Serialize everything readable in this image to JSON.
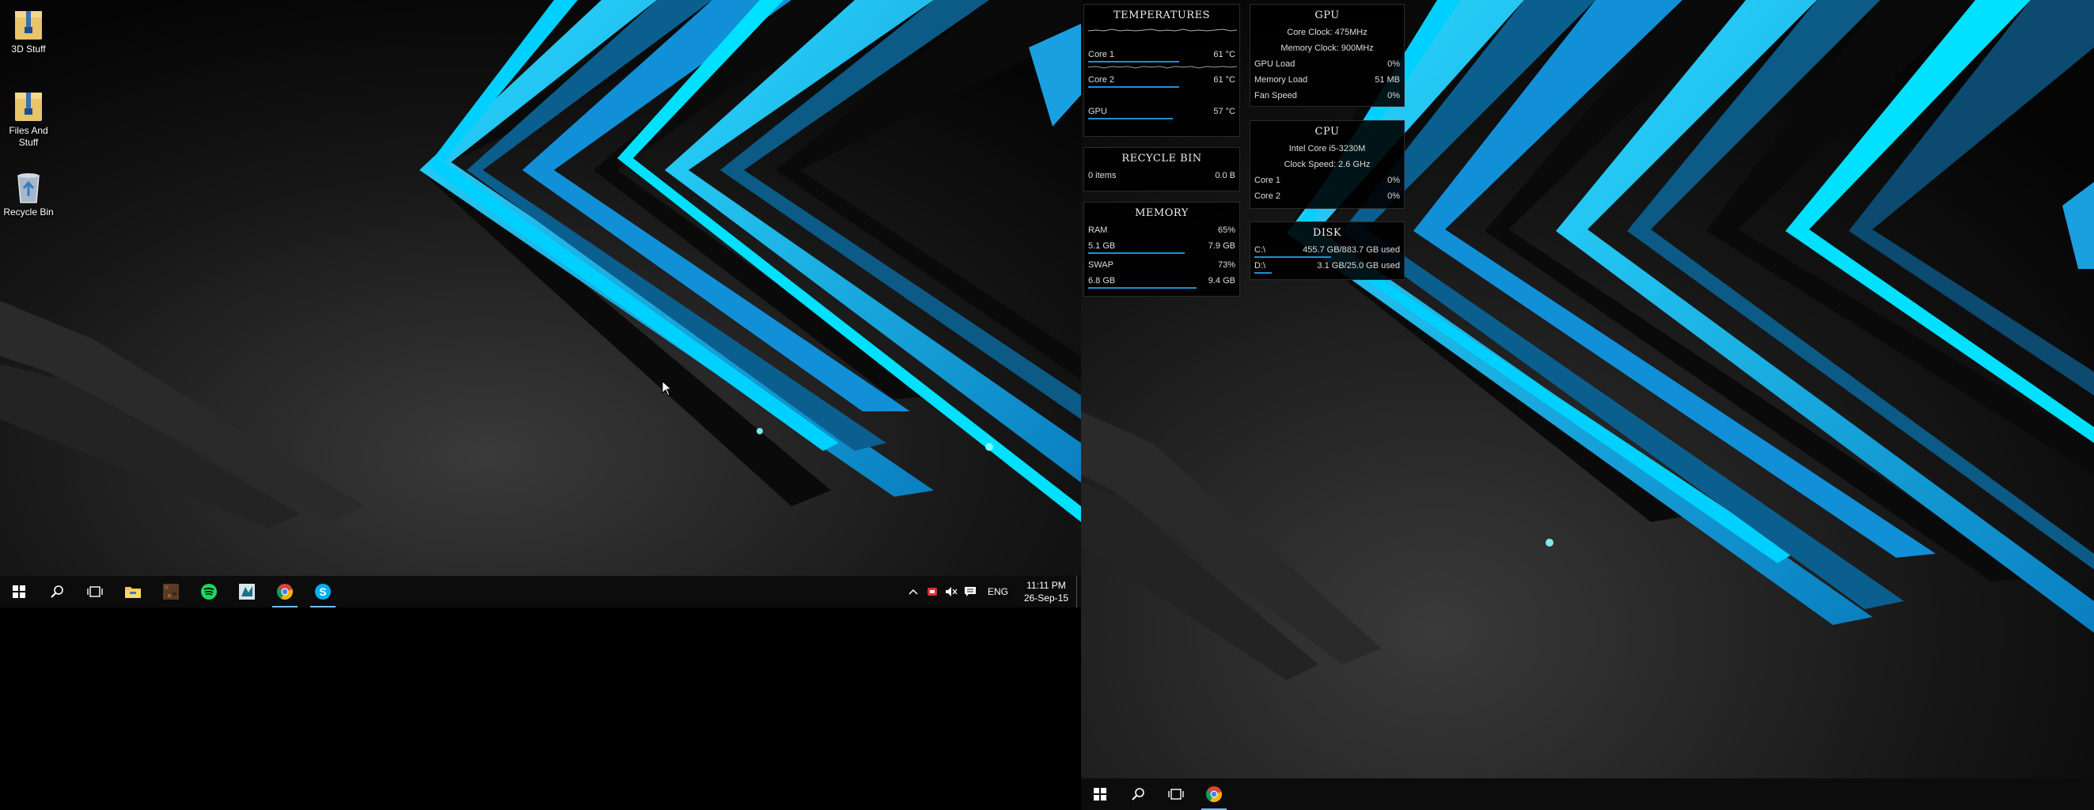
{
  "monitor1": {
    "desktop_icons": [
      {
        "label": "3D Stuff",
        "icon": "zip-folder-icon"
      },
      {
        "label": "Files And Stuff",
        "icon": "zip-folder-icon"
      },
      {
        "label": "Recycle Bin",
        "icon": "recycle-bin-icon"
      }
    ],
    "taskbar": {
      "pinned": [
        "start-icon",
        "search-icon",
        "task-view-icon",
        "file-explorer-icon",
        "minecraft-icon",
        "spotify-icon",
        "app-icon",
        "chrome-icon",
        "skype-icon"
      ],
      "tray": {
        "language": "ENG",
        "time": "11:11 PM",
        "date": "26-Sep-15"
      }
    }
  },
  "monitor2": {
    "taskbar": {
      "pinned": [
        "start-icon",
        "search-icon",
        "task-view-icon",
        "chrome-icon"
      ]
    }
  },
  "widgets": {
    "temperatures": {
      "title": "TEMPERATURES",
      "rows": [
        {
          "label": "Core 1",
          "value": "61 °C",
          "fill": 0.61
        },
        {
          "label": "Core 2",
          "value": "61 °C",
          "fill": 0.61
        },
        {
          "label": "GPU",
          "value": "57 °C",
          "fill": 0.57
        }
      ]
    },
    "recycle_bin": {
      "title": "RECYCLE BIN",
      "items": "0 items",
      "size": "0.0 B"
    },
    "memory": {
      "title": "MEMORY",
      "ram_label": "RAM",
      "ram_percent": "65%",
      "ram_used": "5.1 GB",
      "ram_total": "7.9 GB",
      "ram_fill": 0.65,
      "swap_label": "SWAP",
      "swap_percent": "73%",
      "swap_used": "6.8 GB",
      "swap_total": "9.4 GB",
      "swap_fill": 0.73
    },
    "gpu": {
      "title": "GPU",
      "core_clock": "Core Clock: 475MHz",
      "memory_clock": "Memory Clock: 900MHz",
      "rows": [
        {
          "label": "GPU Load",
          "value": "0%"
        },
        {
          "label": "Memory Load",
          "value": "51 MB"
        },
        {
          "label": "Fan Speed",
          "value": "0%"
        }
      ]
    },
    "cpu": {
      "title": "CPU",
      "model": "Intel Core i5-3230M",
      "clock": "Clock Speed: 2.6 GHz",
      "rows": [
        {
          "label": "Core 1",
          "value": "0%"
        },
        {
          "label": "Core 2",
          "value": "0%"
        }
      ]
    },
    "disk": {
      "title": "DISK",
      "rows": [
        {
          "label": "C:\\",
          "value": "455.7 GB/883.7 GB used",
          "fill": 0.52
        },
        {
          "label": "D:\\",
          "value": "3.1 GB/25.0 GB used",
          "fill": 0.12
        }
      ]
    }
  },
  "colors": {
    "accent": "#1e8fd0",
    "wallpaper_cyan": "#00c8ff",
    "wallpaper_blue": "#0a8fd0",
    "taskbar": "#0c0c0c"
  }
}
